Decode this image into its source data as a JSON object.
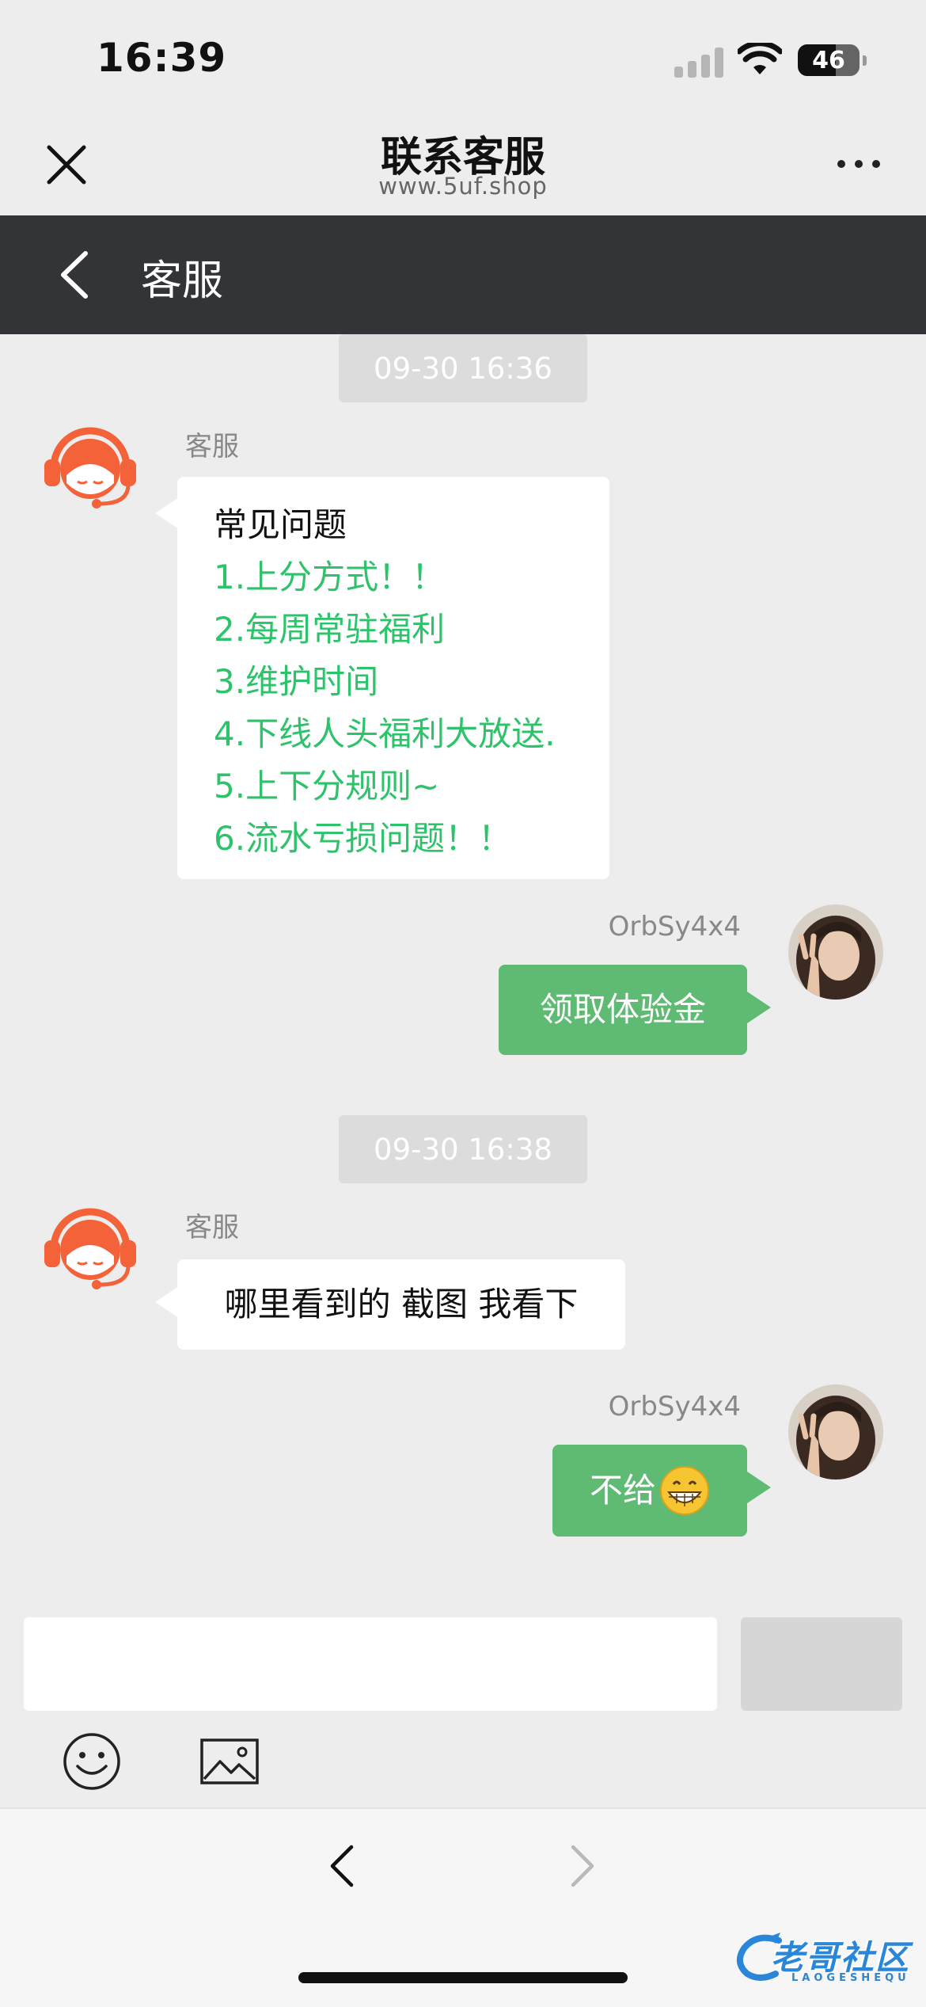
{
  "status_bar": {
    "time": "16:39",
    "battery": "46"
  },
  "nav": {
    "title": "联系客服",
    "subtitle": "www.5uf.shop"
  },
  "chat_header": {
    "title": "客服"
  },
  "messages": [
    {
      "type": "timestamp",
      "text": "09-30 16:36"
    },
    {
      "type": "agent",
      "sender": "客服",
      "heading": "常见问题",
      "items": [
        "1.上分方式！！",
        "2.每周常驻福利",
        "3.维护时间",
        "4.下线人头福利大放送.",
        "5.上下分规则~",
        "6.流水亏损问题！！"
      ]
    },
    {
      "type": "user",
      "sender": "OrbSy4x4",
      "text": "领取体验金"
    },
    {
      "type": "timestamp",
      "text": "09-30 16:38"
    },
    {
      "type": "agent",
      "sender": "客服",
      "text": "哪里看到的 截图 我看下"
    },
    {
      "type": "user",
      "sender": "OrbSy4x4",
      "text": "不给"
    }
  ],
  "input": {
    "value": "",
    "placeholder": ""
  },
  "watermark": {
    "text": "老哥社区",
    "sub": "LAOGESHEQU"
  },
  "colors": {
    "header_bg": "#333437",
    "agent_accent": "#f4623a",
    "user_bubble": "#5fbb73",
    "faq_link": "#2dc36a",
    "page_bg": "#ededed"
  },
  "icons": {
    "close": "close-icon",
    "more": "more-icon",
    "back": "chevron-left-icon",
    "emoji": "smiley-icon",
    "image": "image-icon",
    "agent_avatar": "headset-agent-icon"
  }
}
